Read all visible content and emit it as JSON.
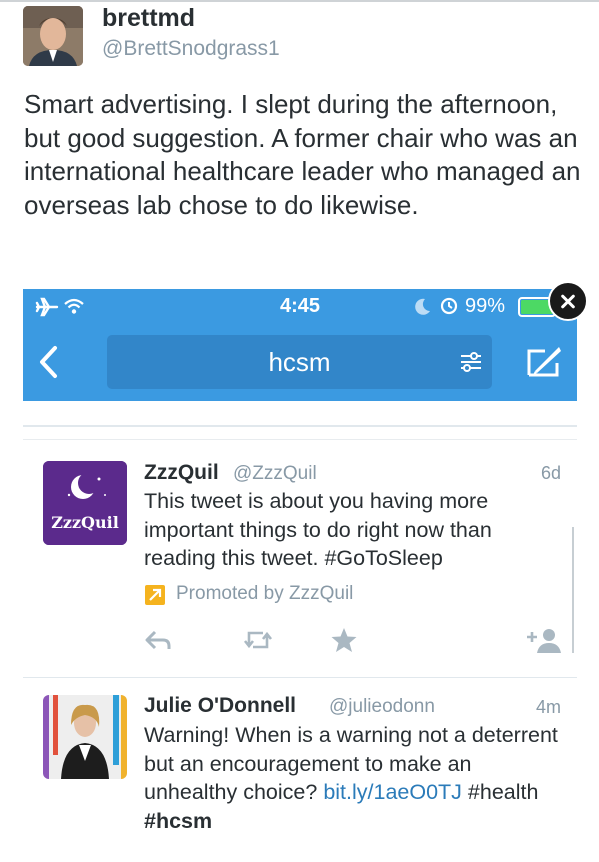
{
  "outer_tweet": {
    "author_name": "brettmd",
    "author_handle": "@BrettSnodgrass1",
    "text": "Smart advertising. I slept during the afternoon, but good suggestion. A former chair who was an international healthcare leader who managed an overseas lab chose to do likewise."
  },
  "status_bar": {
    "time": "4:45",
    "battery": "99%",
    "icons": [
      "airplane-icon",
      "wifi-icon",
      "moon-icon",
      "alarm-icon",
      "battery-icon"
    ]
  },
  "nav": {
    "search_query": "hcsm",
    "icons": [
      "back-icon",
      "filter-icon",
      "compose-icon",
      "close-icon"
    ]
  },
  "tweets": [
    {
      "name": "ZzzQuil",
      "handle": "@ZzzQuil",
      "time": "6d",
      "text": "This tweet is about you having more important things to do right now than reading this tweet. #GoToSleep",
      "avatar_label": "ZzzQuil",
      "promoted": "Promoted by ZzzQuil"
    },
    {
      "name": "Julie O'Donnell",
      "handle": "@julieodonn",
      "time": "4m",
      "text_parts": {
        "plain": "Warning! When is a warning not a deterrent but an encouragement to make an unhealthy choice?",
        "link": "bit.ly/1aeO0TJ",
        "tag": "#health",
        "tag_bold": "#hcsm"
      }
    }
  ],
  "colors": {
    "twitter_blue": "#3b9ae1",
    "search_box": "#3286c9",
    "link": "#2b7bb9",
    "muted": "#8899a6",
    "zzzquil_purple": "#5b2a8c",
    "promoted": "#f5b31e"
  }
}
